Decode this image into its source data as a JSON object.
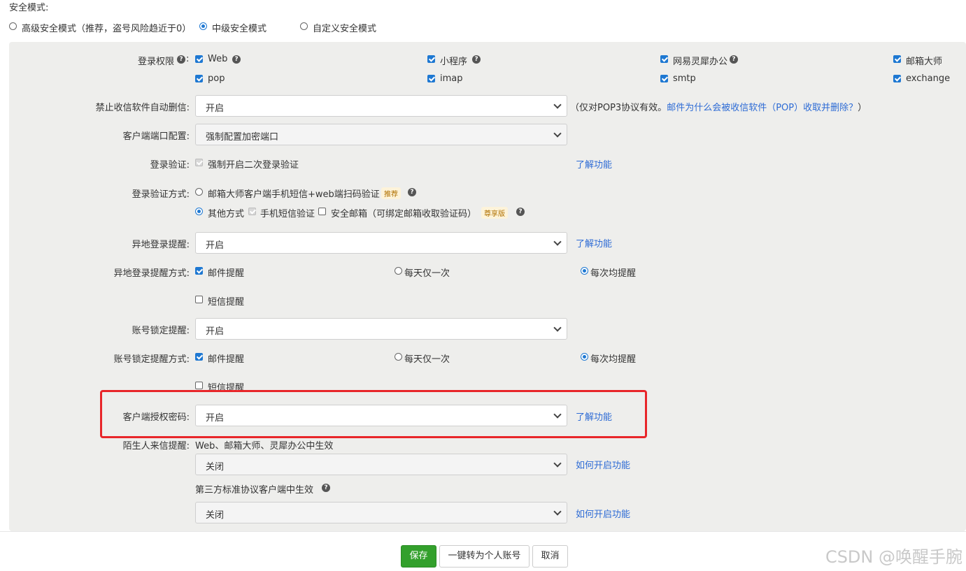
{
  "security_mode": {
    "title": "安全模式:",
    "options": [
      {
        "label": "高级安全模式（推荐，盗号风险趋近于0）",
        "selected": false
      },
      {
        "label": "中级安全模式",
        "selected": true
      },
      {
        "label": "自定义安全模式",
        "selected": false
      }
    ]
  },
  "login_permission": {
    "label": "登录权限",
    "items": [
      {
        "label": "Web",
        "checked": true,
        "help": true
      },
      {
        "label": "小程序",
        "checked": true,
        "help": true
      },
      {
        "label": "网易灵犀办公",
        "checked": true,
        "help": true
      },
      {
        "label": "邮箱大师",
        "checked": true,
        "help": false
      },
      {
        "label": "pop",
        "checked": true
      },
      {
        "label": "imap",
        "checked": true
      },
      {
        "label": "smtp",
        "checked": true
      },
      {
        "label": "exchange",
        "checked": true
      }
    ]
  },
  "no_auto_delete": {
    "label": "禁止收信软件自动删信:",
    "value": "开启",
    "note": "（仅对POP3协议有效。",
    "link": "邮件为什么会被收信软件（POP）收取并删除？",
    "note_end": "）"
  },
  "client_port": {
    "label": "客户端端口配置:",
    "value": "强制配置加密端口"
  },
  "login_verify": {
    "label": "登录验证:",
    "option": "强制开启二次登录验证",
    "link": "了解功能"
  },
  "login_verify_method": {
    "label": "登录验证方式:",
    "option1": "邮箱大师客户端手机短信+web端扫码验证",
    "badge1": "推荐",
    "option2": "其他方式",
    "sms": "手机短信验证",
    "secure_mail": "安全邮箱（可绑定邮箱收取验证码）",
    "badge2": "尊享版"
  },
  "remote_login_alert": {
    "label": "异地登录提醒:",
    "value": "开启",
    "link": "了解功能"
  },
  "remote_login_method": {
    "label": "异地登录提醒方式:",
    "mail": "邮件提醒",
    "once_daily": "每天仅一次",
    "every_time": "每次均提醒",
    "sms": "短信提醒"
  },
  "account_lock_alert": {
    "label": "账号锁定提醒:",
    "value": "开启"
  },
  "account_lock_method": {
    "label": "账号锁定提醒方式:",
    "mail": "邮件提醒",
    "once_daily": "每天仅一次",
    "every_time": "每次均提醒",
    "sms": "短信提醒"
  },
  "client_auth_password": {
    "label": "客户端授权密码:",
    "value": "开启",
    "link": "了解功能"
  },
  "stranger_mail_alert": {
    "label": "陌生人来信提醒:",
    "scope1": "Web、邮箱大师、灵犀办公中生效",
    "value1": "关闭",
    "link1": "如何开启功能",
    "scope2": "第三方标准协议客户端中生效",
    "value2": "关闭",
    "link2": "如何开启功能"
  },
  "footer": {
    "save": "保存",
    "convert": "一键转为个人账号",
    "cancel": "取消"
  },
  "watermark": "CSDN @唤醒手腕",
  "colors": {
    "accent": "#1e78d2",
    "link": "#2d6bd5",
    "save": "#33a02c",
    "highlight": "#e8262a"
  }
}
